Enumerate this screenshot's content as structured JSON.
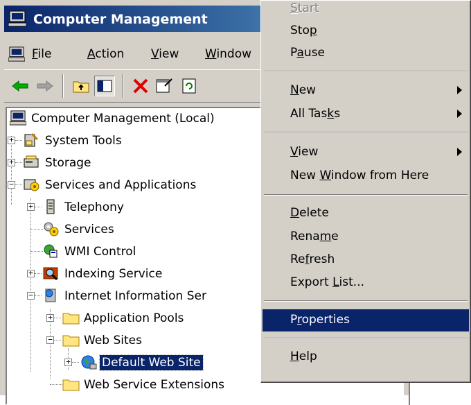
{
  "window": {
    "title": "Computer Management"
  },
  "menubar": {
    "items": [
      {
        "pre": "",
        "key": "F",
        "post": "ile"
      },
      {
        "pre": "",
        "key": "A",
        "post": "ction"
      },
      {
        "pre": "",
        "key": "V",
        "post": "iew"
      },
      {
        "pre": "",
        "key": "W",
        "post": "indow"
      }
    ]
  },
  "toolbar": {
    "icons": [
      "back-arrow-icon",
      "forward-arrow-icon",
      "up-one-level-icon",
      "show-hide-console-tree-icon",
      "delete-icon",
      "properties-icon",
      "refresh-icon"
    ]
  },
  "tree": {
    "items": [
      {
        "label": "Computer Management (Local)"
      },
      {
        "label": "System Tools"
      },
      {
        "label": "Storage"
      },
      {
        "label": "Services and Applications"
      },
      {
        "label": "Telephony"
      },
      {
        "label": "Services"
      },
      {
        "label": "WMI Control"
      },
      {
        "label": "Indexing Service"
      },
      {
        "label": "Internet Information Ser"
      },
      {
        "label": "Application Pools"
      },
      {
        "label": "Web Sites"
      },
      {
        "label": "Default Web Site"
      },
      {
        "label": "Web Service Extensions"
      }
    ]
  },
  "context_menu": {
    "items": [
      {
        "pre": "",
        "key": "S",
        "post": "tart"
      },
      {
        "pre": "Sto",
        "key": "p",
        "post": ""
      },
      {
        "pre": "P",
        "key": "a",
        "post": "use"
      },
      {
        "pre": "",
        "key": "N",
        "post": "ew"
      },
      {
        "pre": "All Tas",
        "key": "k",
        "post": "s"
      },
      {
        "pre": "",
        "key": "V",
        "post": "iew"
      },
      {
        "pre": "New ",
        "key": "W",
        "post": "indow from Here"
      },
      {
        "pre": "",
        "key": "D",
        "post": "elete"
      },
      {
        "pre": "Rena",
        "key": "m",
        "post": "e"
      },
      {
        "pre": "Re",
        "key": "f",
        "post": "resh"
      },
      {
        "pre": "Export ",
        "key": "L",
        "post": "ist..."
      },
      {
        "pre": "P",
        "key": "r",
        "post": "operties"
      },
      {
        "pre": "",
        "key": "H",
        "post": "elp"
      }
    ]
  },
  "colors": {
    "selection": "#0a246a",
    "chrome": "#d4d0c8",
    "title_gradient_start": "#0a246a"
  }
}
